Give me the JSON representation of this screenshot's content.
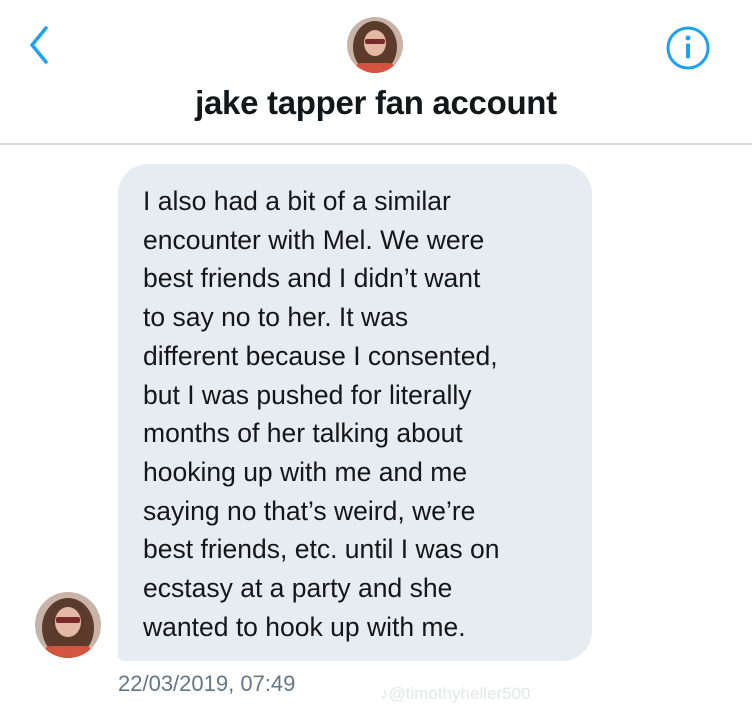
{
  "header": {
    "back_icon": "chevron-left-icon",
    "info_icon": "info-circle-icon",
    "title": "jake tapper fan account"
  },
  "message": {
    "lines": [
      "I also had a bit of a similar",
      "encounter with Mel. We were",
      "best friends and I didn’t want",
      "to say no to her. It was",
      "different because I consented,",
      "but I was pushed for literally",
      "months of her talking about",
      "hooking up with me and me",
      "saying no that’s weird, we’re",
      "best friends, etc. until I was on",
      "ecstasy at a party and she",
      "wanted to hook up with me."
    ],
    "timestamp": "22/03/2019, 07:49"
  },
  "watermark": {
    "text": "♪@timothyheller500"
  },
  "colors": {
    "accent": "#1da1f2",
    "bubble": "#e6ecf0",
    "text": "#14171a",
    "muted": "#657786"
  }
}
